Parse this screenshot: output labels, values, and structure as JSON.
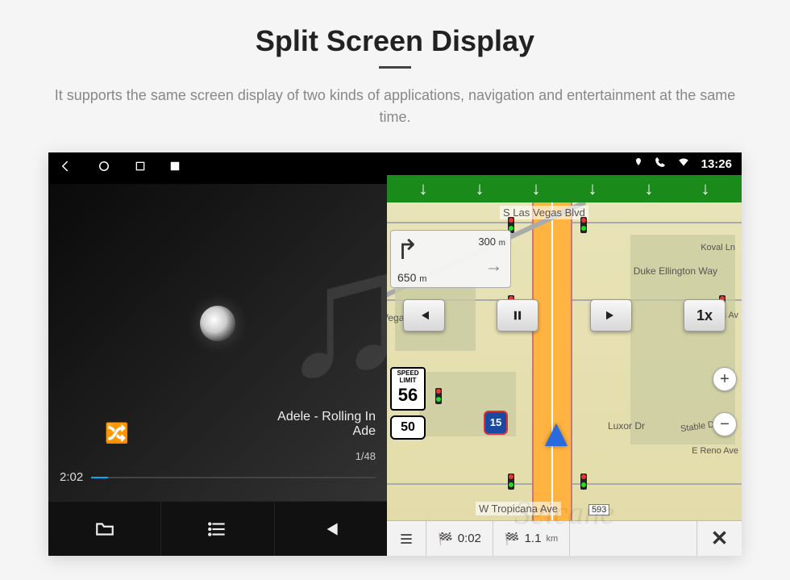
{
  "page": {
    "title": "Split Screen Display",
    "subtitle": "It supports the same screen display of two kinds of applications, navigation and entertainment at the same time."
  },
  "status_bar": {
    "time": "13:26"
  },
  "lanes": [
    "↓",
    "↓",
    "↓",
    "↓",
    "↓",
    "↓"
  ],
  "music": {
    "track_title": "Adele - Rolling In",
    "artist": "Ade",
    "track_index": "1/48",
    "elapsed": "2:02"
  },
  "nav": {
    "turn_next": {
      "value": "300",
      "unit": "m"
    },
    "turn_total": {
      "value": "650",
      "unit": "m"
    },
    "speed_limit_label": "SPEED LIMIT",
    "speed_limit": "56",
    "highway": "50",
    "interstate": "15",
    "playback_speed": "1x",
    "streets": {
      "s_las_vegas": "S Las Vegas Blvd",
      "koval": "Koval Ln",
      "ellington": "Duke Ellington Way",
      "vegas_blvd": "Vegas Blvd",
      "luxor": "Luxor Dr",
      "stable": "Stable Dr",
      "reno": "E Reno Ave",
      "tropicana": "W Tropicana Ave",
      "tropicana_num": "593",
      "iles": "iles Av"
    },
    "footer": {
      "eta": "0:02",
      "dist_value": "1.1",
      "dist_unit": "km"
    }
  },
  "watermark": "Seicane"
}
